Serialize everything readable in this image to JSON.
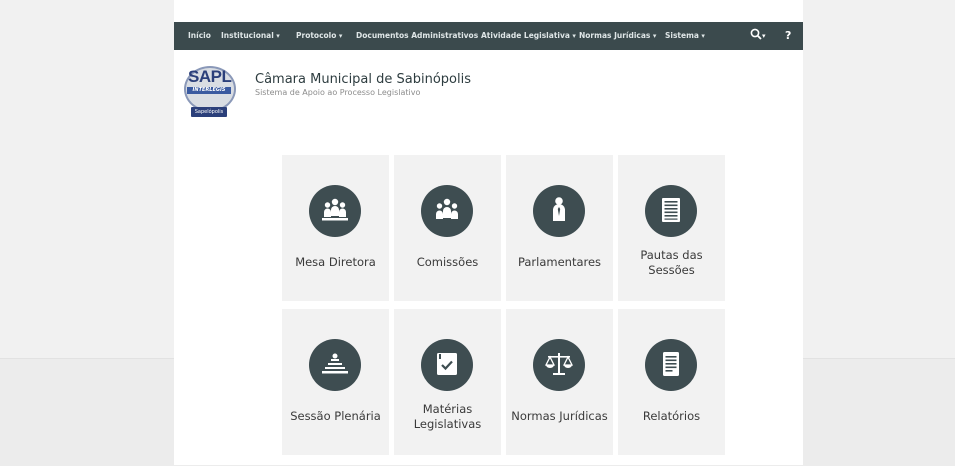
{
  "navbar": {
    "items": [
      {
        "label": "Início",
        "dropdown": false
      },
      {
        "label": "Institucional",
        "dropdown": true
      },
      {
        "label": "Protocolo",
        "dropdown": true
      },
      {
        "label": "Documentos Administrativos",
        "dropdown": false
      },
      {
        "label": "Atividade Legislativa",
        "dropdown": true
      },
      {
        "label": "Normas Jurídicas",
        "dropdown": true
      },
      {
        "label": "Sistema",
        "dropdown": true
      }
    ],
    "search_icon": "search-icon",
    "help_label": "?"
  },
  "logo": {
    "text": "SAPL",
    "band_text": "INTERLEGIS",
    "tag_text": "Sapelópolis"
  },
  "header": {
    "title": "Câmara Municipal de Sabinópolis",
    "subtitle": "Sistema de Apoio ao Processo Legislativo"
  },
  "tiles": [
    {
      "label": "Mesa Diretora",
      "icon": "group-icon"
    },
    {
      "label": "Comissões",
      "icon": "group-icon"
    },
    {
      "label": "Parlamentares",
      "icon": "person-icon"
    },
    {
      "label": "Pautas das Sessões",
      "icon": "list-icon"
    },
    {
      "label": "Sessão Plenária",
      "icon": "plenary-icon"
    },
    {
      "label": "Matérias Legislativas",
      "icon": "checked-document-icon"
    },
    {
      "label": "Normas Jurídicas",
      "icon": "scales-icon"
    },
    {
      "label": "Relatórios",
      "icon": "document-icon"
    }
  ],
  "colors": {
    "navbar": "#3b4a4d",
    "icon_circle": "#3e4d51",
    "tile_bg": "#f2f2f2"
  }
}
